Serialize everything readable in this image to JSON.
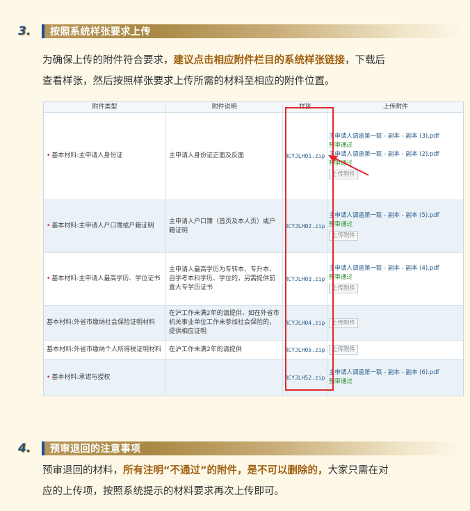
{
  "section3": {
    "number": "3.",
    "title": "按照系统样张要求上传",
    "para_lines": [
      {
        "pre": "为确保上传的附件符合要求，",
        "bold": "建议点击相应附件栏目的系统样张链接",
        "post": "，下载后"
      },
      {
        "pre": "查看样张，然后按照样张要求上传所需的材料至相应的附件位置。",
        "bold": "",
        "post": ""
      }
    ]
  },
  "table": {
    "headers": [
      "附件类型",
      "附件说明",
      "样张",
      "上传附件"
    ],
    "upload_label": "上传附件",
    "rows": [
      {
        "type": "基本材料:主申请人身份证",
        "required": true,
        "desc": "主申请人身份证正面及反面",
        "sample": "RCYJLH01.zip",
        "attachments": [
          {
            "link": "主申请人调函第一联 - 副本 - 副本 (3).pdf",
            "status": "预审通过"
          },
          {
            "link": "主申请人调函第一联 - 副本 - 副本 (2).pdf",
            "status": "预审通过"
          }
        ]
      },
      {
        "type": "基本材料:主申请人户口簿或户籍证明",
        "required": true,
        "desc": "主申请人户口簿（首页及本人页）或户籍证明",
        "sample": "RCYJLH02.zip",
        "attachments": [
          {
            "link": "主申请人调函第一联 - 副本 - 副本 (5).pdf",
            "status": "预审通过"
          }
        ]
      },
      {
        "type": "基本材料:主申请人最高学历、学位证书",
        "required": true,
        "desc": "主申请人最高学历为专转本、专升本、自学考本科学历、学位的，另需提供前置大专学历证书",
        "sample": "RCYJLH03.zip",
        "attachments": [
          {
            "link": "主申请人调函第一联 - 副本 - 副本 (4).pdf",
            "status": "预审通过"
          }
        ]
      },
      {
        "type": "基本材料:外省市缴纳社会保险证明材料",
        "required": false,
        "desc": "在沪工作未满2年的请提供，如在外省市机关事业单位工作未参加社会保险的，提供相应证明",
        "sample": "RCYJLH04.zip",
        "attachments": []
      },
      {
        "type": "基本材料:外省市缴纳个人所得税证明材料",
        "required": false,
        "desc": "在沪工作未满2年的请提供",
        "sample": "RCYJLH05.zip",
        "attachments": []
      },
      {
        "type": "基本材料:承诺与授权",
        "required": true,
        "desc": "",
        "sample": "RCYJLH52.zip",
        "attachments": [
          {
            "link": "主申请人调函第一联 - 副本 - 副本 (6).pdf",
            "status": "预审通过"
          }
        ]
      }
    ]
  },
  "section4": {
    "number": "4.",
    "title": "预审退回的注意事项",
    "para_lines": [
      {
        "pre": "预审退回的材料，",
        "bold": "所有注明“不通过”的附件，是不可以删除的，",
        "post": "大家只需在对"
      },
      {
        "pre": "应的上传项，按照系统提示的材料要求再次上传即可。",
        "bold": "",
        "post": ""
      }
    ]
  },
  "colors": {
    "accent_blue": "#1e4f8c",
    "bold_brown": "#a0600f",
    "highlight_red": "#e0282c",
    "ok_green": "#2d8a2d"
  }
}
